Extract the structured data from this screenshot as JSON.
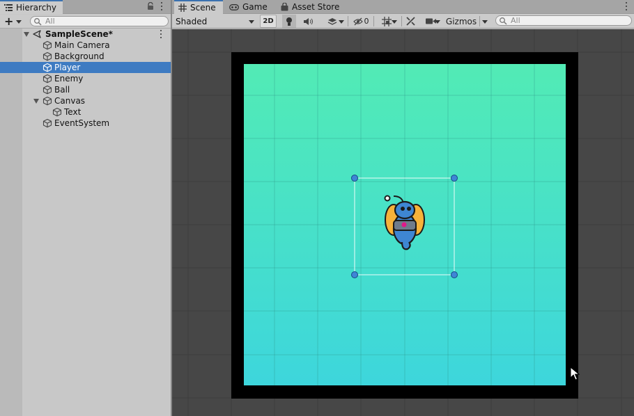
{
  "hierarchy": {
    "tab_label": "Hierarchy",
    "search_placeholder": "All",
    "icons": {
      "tab": "list-icon",
      "lock": "lock-icon",
      "menu": "kebab-menu-icon",
      "add": "plus-icon",
      "search": "search-icon"
    },
    "scene_name": "SampleScene*",
    "items": [
      {
        "label": "Main Camera",
        "icon": "gameobject-cube-icon"
      },
      {
        "label": "Background",
        "icon": "gameobject-cube-icon"
      },
      {
        "label": "Player",
        "icon": "gameobject-cube-icon",
        "selected": true
      },
      {
        "label": "Enemy",
        "icon": "gameobject-cube-icon"
      },
      {
        "label": "Ball",
        "icon": "gameobject-cube-icon"
      },
      {
        "label": "Canvas",
        "icon": "gameobject-cube-icon",
        "expanded": true
      },
      {
        "label": "Text",
        "icon": "gameobject-cube-icon",
        "parent": "Canvas"
      },
      {
        "label": "EventSystem",
        "icon": "gameobject-cube-icon"
      }
    ]
  },
  "scene_view": {
    "tabs": [
      {
        "label": "Scene",
        "icon": "grid-hash-icon",
        "active": true
      },
      {
        "label": "Game",
        "icon": "gamepad-icon"
      },
      {
        "label": "Asset Store",
        "icon": "shopping-bag-icon"
      }
    ],
    "toolbar": {
      "draw_mode": "Shaded",
      "mode_2d_label": "2D",
      "hidden_count": "0",
      "gizmos_label": "Gizmos",
      "search_placeholder": "All",
      "icons": [
        "lighting-bulb-icon",
        "audio-speaker-icon",
        "effects-layers-icon",
        "visibility-eye-icon",
        "grid-snap-icon",
        "tools-icon",
        "camera-icon"
      ]
    },
    "colors": {
      "viewport_bg": "#474747",
      "camera_border": "#000000",
      "gradient_top": "#52ebb5",
      "gradient_bottom": "#3dd6dc",
      "selection_handle": "#3f86d6",
      "selected_row": "#3e7bc2"
    }
  }
}
